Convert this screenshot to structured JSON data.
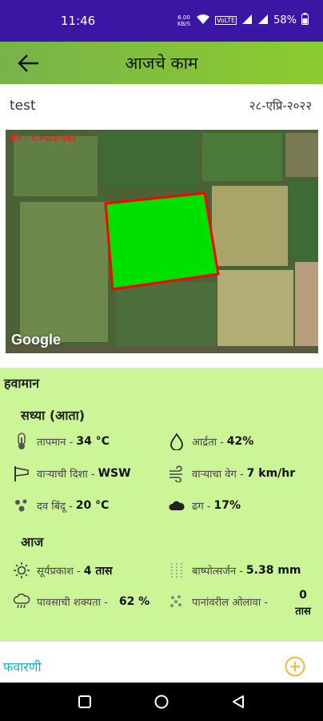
{
  "status_bar": {
    "time": "11:46",
    "battery": "58%",
    "data_rate": "6.00 KB/S"
  },
  "app_bar": {
    "title": "आजचे काम"
  },
  "farm": {
    "name": "test",
    "date": "२८-एप्रि-२०२२"
  },
  "map": {
    "area_label": "क्षेत्र - १.०५८३ एकर",
    "provider": "Google"
  },
  "weather": {
    "heading": "हवामान",
    "current_heading": "सध्या (आता)",
    "current": [
      {
        "icon": "thermometer-icon",
        "label": "तापमान -",
        "value": "34 °C"
      },
      {
        "icon": "drop-icon",
        "label": "आर्द्रता -",
        "value": "42%"
      },
      {
        "icon": "windsock-icon",
        "label": "वाऱ्याची दिशा -",
        "value": "WSW"
      },
      {
        "icon": "wind-icon",
        "label": "वाऱ्याचा वेग -",
        "value": "7 km/hr"
      },
      {
        "icon": "dewpoint-icon",
        "label": "दव बिंदू -",
        "value": "20 °C"
      },
      {
        "icon": "cloud-icon",
        "label": "ढग -",
        "value": "17%"
      }
    ],
    "today_heading": "आज",
    "today": [
      {
        "icon": "sun-icon",
        "label": "सूर्यप्रकाश -",
        "value": "4 तास"
      },
      {
        "icon": "evaporation-icon",
        "label": "बाष्पोत्सर्जन -",
        "value": "5.38 mm"
      },
      {
        "icon": "rain-icon",
        "label": "पावसाची शक्यता -",
        "value": "62 %"
      },
      {
        "icon": "leaf-wetness-icon",
        "label": "पानांवरील ओलावा -",
        "value": "0",
        "unit": "तास"
      }
    ]
  },
  "bottom": {
    "label": "फवारणी"
  },
  "colors": {
    "status_bar": "#3b16a4",
    "app_bar": "#8ccc2f",
    "weather_bg": "#ccf598",
    "field_fill": "#00e000",
    "field_border": "#ff0000",
    "accent_teal": "#19b2c2",
    "add_button": "#f5b73b"
  }
}
